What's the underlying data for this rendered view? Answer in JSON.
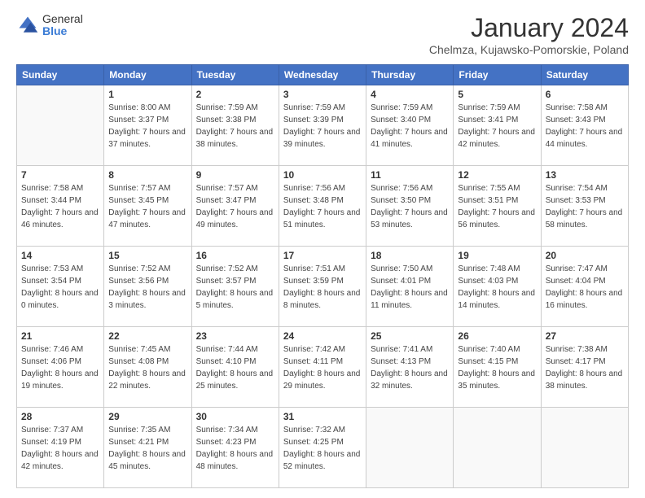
{
  "logo": {
    "general": "General",
    "blue": "Blue"
  },
  "title": "January 2024",
  "subtitle": "Chelmza, Kujawsko-Pomorskie, Poland",
  "headers": [
    "Sunday",
    "Monday",
    "Tuesday",
    "Wednesday",
    "Thursday",
    "Friday",
    "Saturday"
  ],
  "weeks": [
    [
      {
        "day": "",
        "sunrise": "",
        "sunset": "",
        "daylight": ""
      },
      {
        "day": "1",
        "sunrise": "Sunrise: 8:00 AM",
        "sunset": "Sunset: 3:37 PM",
        "daylight": "Daylight: 7 hours and 37 minutes."
      },
      {
        "day": "2",
        "sunrise": "Sunrise: 7:59 AM",
        "sunset": "Sunset: 3:38 PM",
        "daylight": "Daylight: 7 hours and 38 minutes."
      },
      {
        "day": "3",
        "sunrise": "Sunrise: 7:59 AM",
        "sunset": "Sunset: 3:39 PM",
        "daylight": "Daylight: 7 hours and 39 minutes."
      },
      {
        "day": "4",
        "sunrise": "Sunrise: 7:59 AM",
        "sunset": "Sunset: 3:40 PM",
        "daylight": "Daylight: 7 hours and 41 minutes."
      },
      {
        "day": "5",
        "sunrise": "Sunrise: 7:59 AM",
        "sunset": "Sunset: 3:41 PM",
        "daylight": "Daylight: 7 hours and 42 minutes."
      },
      {
        "day": "6",
        "sunrise": "Sunrise: 7:58 AM",
        "sunset": "Sunset: 3:43 PM",
        "daylight": "Daylight: 7 hours and 44 minutes."
      }
    ],
    [
      {
        "day": "7",
        "sunrise": "Sunrise: 7:58 AM",
        "sunset": "Sunset: 3:44 PM",
        "daylight": "Daylight: 7 hours and 46 minutes."
      },
      {
        "day": "8",
        "sunrise": "Sunrise: 7:57 AM",
        "sunset": "Sunset: 3:45 PM",
        "daylight": "Daylight: 7 hours and 47 minutes."
      },
      {
        "day": "9",
        "sunrise": "Sunrise: 7:57 AM",
        "sunset": "Sunset: 3:47 PM",
        "daylight": "Daylight: 7 hours and 49 minutes."
      },
      {
        "day": "10",
        "sunrise": "Sunrise: 7:56 AM",
        "sunset": "Sunset: 3:48 PM",
        "daylight": "Daylight: 7 hours and 51 minutes."
      },
      {
        "day": "11",
        "sunrise": "Sunrise: 7:56 AM",
        "sunset": "Sunset: 3:50 PM",
        "daylight": "Daylight: 7 hours and 53 minutes."
      },
      {
        "day": "12",
        "sunrise": "Sunrise: 7:55 AM",
        "sunset": "Sunset: 3:51 PM",
        "daylight": "Daylight: 7 hours and 56 minutes."
      },
      {
        "day": "13",
        "sunrise": "Sunrise: 7:54 AM",
        "sunset": "Sunset: 3:53 PM",
        "daylight": "Daylight: 7 hours and 58 minutes."
      }
    ],
    [
      {
        "day": "14",
        "sunrise": "Sunrise: 7:53 AM",
        "sunset": "Sunset: 3:54 PM",
        "daylight": "Daylight: 8 hours and 0 minutes."
      },
      {
        "day": "15",
        "sunrise": "Sunrise: 7:52 AM",
        "sunset": "Sunset: 3:56 PM",
        "daylight": "Daylight: 8 hours and 3 minutes."
      },
      {
        "day": "16",
        "sunrise": "Sunrise: 7:52 AM",
        "sunset": "Sunset: 3:57 PM",
        "daylight": "Daylight: 8 hours and 5 minutes."
      },
      {
        "day": "17",
        "sunrise": "Sunrise: 7:51 AM",
        "sunset": "Sunset: 3:59 PM",
        "daylight": "Daylight: 8 hours and 8 minutes."
      },
      {
        "day": "18",
        "sunrise": "Sunrise: 7:50 AM",
        "sunset": "Sunset: 4:01 PM",
        "daylight": "Daylight: 8 hours and 11 minutes."
      },
      {
        "day": "19",
        "sunrise": "Sunrise: 7:48 AM",
        "sunset": "Sunset: 4:03 PM",
        "daylight": "Daylight: 8 hours and 14 minutes."
      },
      {
        "day": "20",
        "sunrise": "Sunrise: 7:47 AM",
        "sunset": "Sunset: 4:04 PM",
        "daylight": "Daylight: 8 hours and 16 minutes."
      }
    ],
    [
      {
        "day": "21",
        "sunrise": "Sunrise: 7:46 AM",
        "sunset": "Sunset: 4:06 PM",
        "daylight": "Daylight: 8 hours and 19 minutes."
      },
      {
        "day": "22",
        "sunrise": "Sunrise: 7:45 AM",
        "sunset": "Sunset: 4:08 PM",
        "daylight": "Daylight: 8 hours and 22 minutes."
      },
      {
        "day": "23",
        "sunrise": "Sunrise: 7:44 AM",
        "sunset": "Sunset: 4:10 PM",
        "daylight": "Daylight: 8 hours and 25 minutes."
      },
      {
        "day": "24",
        "sunrise": "Sunrise: 7:42 AM",
        "sunset": "Sunset: 4:11 PM",
        "daylight": "Daylight: 8 hours and 29 minutes."
      },
      {
        "day": "25",
        "sunrise": "Sunrise: 7:41 AM",
        "sunset": "Sunset: 4:13 PM",
        "daylight": "Daylight: 8 hours and 32 minutes."
      },
      {
        "day": "26",
        "sunrise": "Sunrise: 7:40 AM",
        "sunset": "Sunset: 4:15 PM",
        "daylight": "Daylight: 8 hours and 35 minutes."
      },
      {
        "day": "27",
        "sunrise": "Sunrise: 7:38 AM",
        "sunset": "Sunset: 4:17 PM",
        "daylight": "Daylight: 8 hours and 38 minutes."
      }
    ],
    [
      {
        "day": "28",
        "sunrise": "Sunrise: 7:37 AM",
        "sunset": "Sunset: 4:19 PM",
        "daylight": "Daylight: 8 hours and 42 minutes."
      },
      {
        "day": "29",
        "sunrise": "Sunrise: 7:35 AM",
        "sunset": "Sunset: 4:21 PM",
        "daylight": "Daylight: 8 hours and 45 minutes."
      },
      {
        "day": "30",
        "sunrise": "Sunrise: 7:34 AM",
        "sunset": "Sunset: 4:23 PM",
        "daylight": "Daylight: 8 hours and 48 minutes."
      },
      {
        "day": "31",
        "sunrise": "Sunrise: 7:32 AM",
        "sunset": "Sunset: 4:25 PM",
        "daylight": "Daylight: 8 hours and 52 minutes."
      },
      {
        "day": "",
        "sunrise": "",
        "sunset": "",
        "daylight": ""
      },
      {
        "day": "",
        "sunrise": "",
        "sunset": "",
        "daylight": ""
      },
      {
        "day": "",
        "sunrise": "",
        "sunset": "",
        "daylight": ""
      }
    ]
  ]
}
